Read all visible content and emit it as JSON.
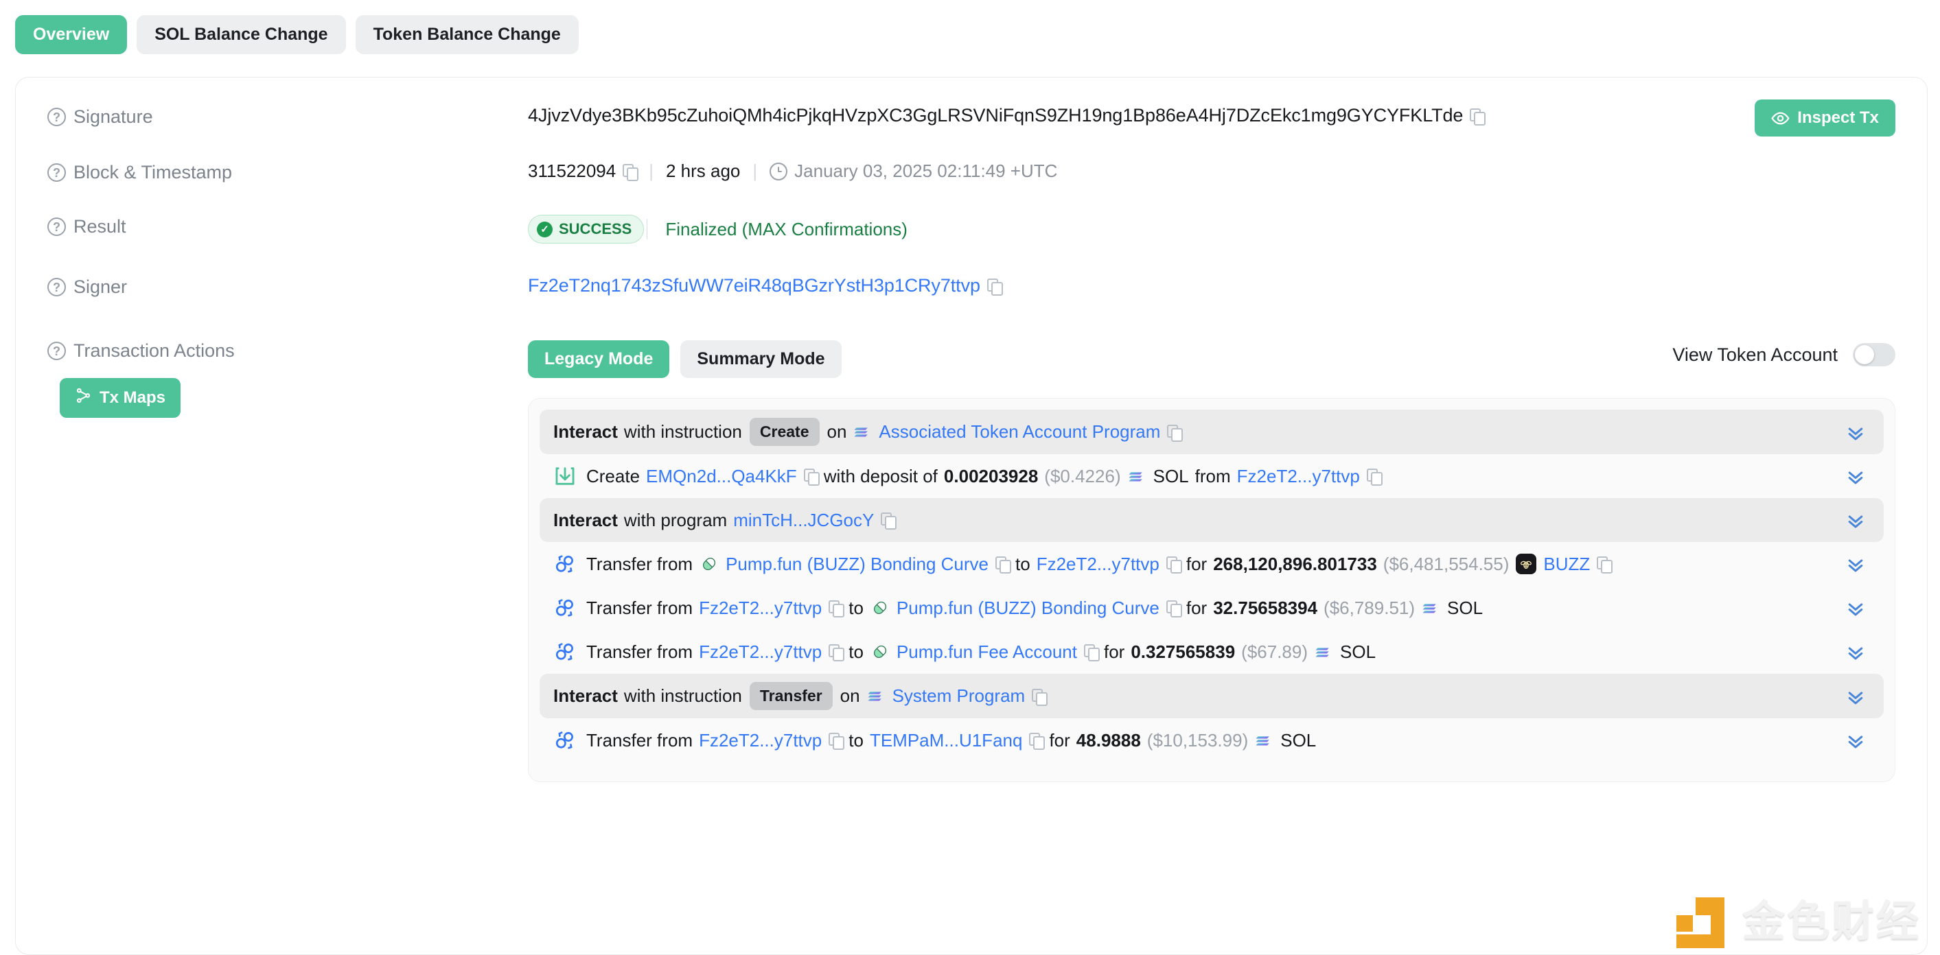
{
  "tabs": [
    {
      "label": "Overview",
      "active": true
    },
    {
      "label": "SOL Balance Change",
      "active": false
    },
    {
      "label": "Token Balance Change",
      "active": false
    }
  ],
  "details": {
    "signature": {
      "label": "Signature",
      "value": "4JjvzVdye3BKb95cZuhoiQMh4icPjkqHVzpXC3GgLRSVNiFqnS9ZH19ng1Bp86eA4Hj7DZcEkc1mg9GYCYFKLTde"
    },
    "block": {
      "label": "Block & Timestamp",
      "slot": "311522094",
      "relative": "2 hrs ago",
      "timestamp": "January 03, 2025 02:11:49 +UTC"
    },
    "result": {
      "label": "Result",
      "status": "SUCCESS",
      "confirmation": "Finalized (MAX Confirmations)"
    },
    "signer": {
      "label": "Signer",
      "address": "Fz2eT2nq1743zSfuWW7eiR48qBGzrYstH3p1CRy7ttvp"
    },
    "inspect_button": "Inspect Tx"
  },
  "transaction_actions": {
    "label": "Transaction Actions",
    "tx_maps_button": "Tx Maps",
    "modes": [
      {
        "label": "Legacy Mode",
        "active": true
      },
      {
        "label": "Summary Mode",
        "active": false
      }
    ],
    "view_token_account": {
      "label": "View Token Account",
      "enabled": false
    },
    "rows": [
      {
        "kind": "header",
        "icon": "solana-icon",
        "prefix_bold": "Interact",
        "prefix": "with instruction",
        "pill": "Create",
        "mid": "on",
        "program": "Associated Token Account Program"
      },
      {
        "kind": "create",
        "icon": "download-icon",
        "verb": "Create",
        "account": "EMQn2d...Qa4KkF",
        "mid": "with deposit of",
        "amount": "0.00203928",
        "usd": "($0.4226)",
        "token": "SOL",
        "token_icon": "solana-icon",
        "from_label": "from",
        "from": "Fz2eT2...y7ttvp"
      },
      {
        "kind": "header",
        "prefix_bold": "Interact",
        "prefix": "with program",
        "program": "minTcH...JCGocY"
      },
      {
        "kind": "transfer",
        "icon": "transfer-icon",
        "verb": "Transfer from",
        "from_icon": "pumpfun-icon",
        "from": "Pump.fun (BUZZ) Bonding Curve",
        "to_label": "to",
        "to": "Fz2eT2...y7ttvp",
        "for_label": "for",
        "amount": "268,120,896.801733",
        "usd": "($6,481,554.55)",
        "token_icon": "buzz-icon",
        "token": "BUZZ"
      },
      {
        "kind": "transfer",
        "icon": "transfer-icon",
        "verb": "Transfer from",
        "from": "Fz2eT2...y7ttvp",
        "to_label": "to",
        "to_icon": "pumpfun-icon",
        "to": "Pump.fun (BUZZ) Bonding Curve",
        "for_label": "for",
        "amount": "32.75658394",
        "usd": "($6,789.51)",
        "token_icon": "solana-icon",
        "token": "SOL"
      },
      {
        "kind": "transfer",
        "icon": "transfer-icon",
        "verb": "Transfer from",
        "from": "Fz2eT2...y7ttvp",
        "to_label": "to",
        "to_icon": "pumpfun-icon",
        "to": "Pump.fun Fee Account",
        "for_label": "for",
        "amount": "0.327565839",
        "usd": "($67.89)",
        "token_icon": "solana-icon",
        "token": "SOL"
      },
      {
        "kind": "header",
        "icon": "solana-icon",
        "prefix_bold": "Interact",
        "prefix": "with instruction",
        "pill": "Transfer",
        "mid": "on",
        "program": "System Program"
      },
      {
        "kind": "transfer",
        "icon": "transfer-icon",
        "verb": "Transfer from",
        "from": "Fz2eT2...y7ttvp",
        "to_label": "to",
        "to": "TEMPaM...U1Fanq",
        "for_label": "for",
        "amount": "48.9888",
        "usd": "($10,153.99)",
        "token_icon": "solana-icon",
        "token": "SOL"
      }
    ]
  },
  "watermark": {
    "text": "金色财经"
  },
  "colors": {
    "accent_green": "#4ec39a",
    "link_blue": "#3478f6",
    "success_green": "#1a7f43",
    "watermark_orange": "#f0a018"
  }
}
